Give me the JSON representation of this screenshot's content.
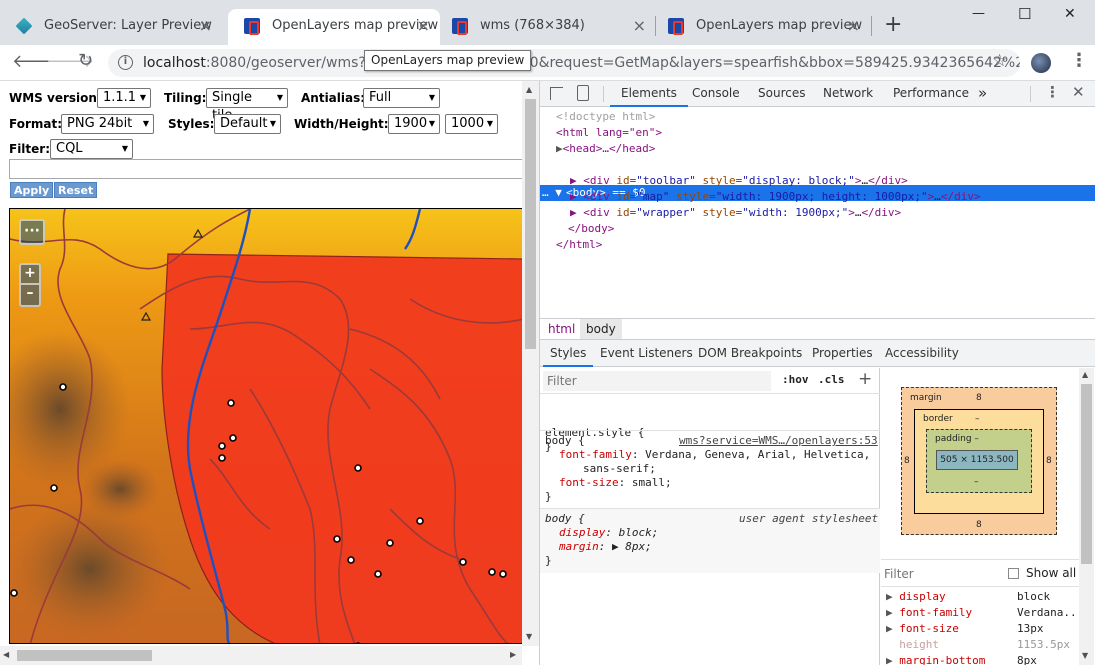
{
  "browser": {
    "tabs": [
      {
        "title": "GeoServer: Layer Preview",
        "icon": "geoserver-icon",
        "active": false
      },
      {
        "title": "OpenLayers map preview",
        "icon": "openlayers-icon",
        "active": true
      },
      {
        "title": "wms (768×384)",
        "icon": "openlayers-icon",
        "active": false
      },
      {
        "title": "OpenLayers map preview",
        "icon": "openlayers-icon",
        "active": false
      }
    ],
    "new_tab_label": "+",
    "close_label": "×",
    "url_host": "localhost",
    "url_rest": ":8080/geoserver/wms?servi",
    "url_tail": "0&request=GetMap&layers=spearfish&bbox=589425.9342365642%2C49...",
    "tooltip": "OpenLayers map preview",
    "window_controls": {
      "minimize": "—",
      "maximize": "☐",
      "close": "✕"
    }
  },
  "toolbar": {
    "wms_version_label": "WMS version:",
    "wms_version_value": "1.1.1",
    "tiling_label": "Tiling:",
    "tiling_value": "Single tile",
    "antialias_label": "Antialias:",
    "antialias_value": "Full",
    "format_label": "Format:",
    "format_value": "PNG 24bit",
    "styles_label": "Styles:",
    "styles_value": "Default",
    "size_label": "Width/Height:",
    "width_value": "1900",
    "height_value": "1000",
    "filter_label": "Filter:",
    "filter_value": "CQL",
    "apply_label": "Apply",
    "reset_label": "Reset"
  },
  "map": {
    "more_label": "···",
    "zoom_in_label": "+",
    "zoom_out_label": "–"
  },
  "devtools": {
    "tabs": [
      "Elements",
      "Console",
      "Sources",
      "Network",
      "Performance"
    ],
    "active_tab": "Elements",
    "more_tabs_label": "»",
    "dom": {
      "doctype": "<!doctype html>",
      "html_open": "<html lang=\"en\">",
      "head": "<head>…</head>",
      "body_line": "<body> == $0",
      "div1_id": "toolbar",
      "div1_style": "display: block;",
      "div2_id": "map",
      "div2_style": "width: 1900px; height: 1000px;",
      "div3_id": "wrapper",
      "div3_style": "width: 1900px;",
      "body_close": "</body>",
      "html_close": "</html>"
    },
    "breadcrumbs": [
      "html",
      "body"
    ],
    "style_tabs": [
      "Styles",
      "Event Listeners",
      "DOM Breakpoints",
      "Properties",
      "Accessibility"
    ],
    "filter_placeholder": "Filter",
    "hov_label": ":hov",
    "cls_label": ".cls",
    "rules": {
      "element_style": "element.style {",
      "close_brace": "}",
      "body_selector": "body {",
      "body_source": "wms?service=WMS…/openlayers:53",
      "font_family_prop": "font-family",
      "font_family_val": "Verdana, Geneva, Arial, Helvetica,",
      "font_family_val2": "sans-serif;",
      "font_size_prop": "font-size",
      "font_size_val": "small;",
      "ua_selector": "body {",
      "ua_source": "user agent stylesheet",
      "display_prop": "display",
      "display_val": "block;",
      "margin_prop": "margin",
      "margin_val": "8px;"
    },
    "box_model": {
      "margin_label": "margin",
      "margin_top": "8",
      "margin_bottom": "8",
      "margin_left": "8",
      "margin_right": "8",
      "border_label": "border",
      "border_value": "–",
      "padding_label": "padding –",
      "padding_value": "–",
      "content_size": "505 × 1153.500"
    },
    "computed_filter_placeholder": "Filter",
    "show_all_label": "Show all",
    "computed": [
      {
        "prop": "display",
        "value": "block"
      },
      {
        "prop": "font-family",
        "value": "Verdana..."
      },
      {
        "prop": "font-size",
        "value": "13px"
      },
      {
        "prop": "height",
        "value": "1153.5px"
      },
      {
        "prop": "margin-bottom",
        "value": "8px"
      }
    ]
  }
}
